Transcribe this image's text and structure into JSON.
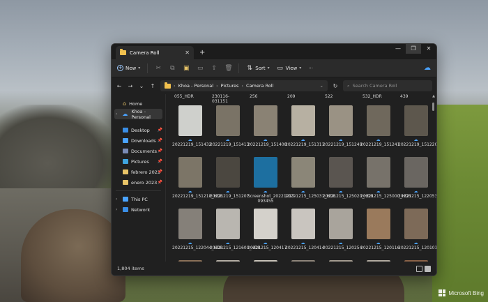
{
  "window": {
    "tab_title": "Camera Roll",
    "new_tab": "+",
    "close": "✕",
    "minimize": "—",
    "maximize": "❐",
    "window_close": "✕"
  },
  "toolbar": {
    "new_label": "New",
    "sort_label": "Sort",
    "view_label": "View",
    "more": "···"
  },
  "address": {
    "crumbs": [
      "Khoa - Personal",
      "Pictures",
      "Camera Roll"
    ],
    "search_placeholder": "Search Camera Roll"
  },
  "sidebar": {
    "home": "Home",
    "personal": "Khoa - Personal",
    "quick": [
      {
        "label": "Desktop",
        "color": "#3a8ee6"
      },
      {
        "label": "Downloads",
        "color": "#4aa3ff"
      },
      {
        "label": "Documents",
        "color": "#7a8bb5"
      },
      {
        "label": "Pictures",
        "color": "#3fa5e0"
      },
      {
        "label": "febrero 2023",
        "color": "#e8c468"
      },
      {
        "label": "enero 2023",
        "color": "#e8c468"
      }
    ],
    "this_pc": "This PC",
    "network": "Network"
  },
  "top_row": [
    "055_HDR",
    "230116-031151",
    "256",
    "209",
    "522",
    "532_HDR",
    "439"
  ],
  "files": [
    {
      "name": "20221219_151432",
      "bg": "#cfd0cc"
    },
    {
      "name": "20221219_151413",
      "bg": "#7a7366"
    },
    {
      "name": "20221219_151408",
      "bg": "#8a8274"
    },
    {
      "name": "20221219_151311",
      "bg": "#b7b0a2"
    },
    {
      "name": "20221219_151249",
      "bg": "#9a9284"
    },
    {
      "name": "20221219_151241",
      "bg": "#6f685c"
    },
    {
      "name": "20221219_151220_HDR",
      "bg": "#5d574d"
    },
    {
      "name": "20221219_151218_HDR",
      "bg": "#7c7567"
    },
    {
      "name": "20221219_151207",
      "bg": "#4b4740"
    },
    {
      "name": "Screenshot_20221217-093455",
      "bg": "#1d6fa0"
    },
    {
      "name": "20221215_125031_HDR",
      "bg": "#8b8678"
    },
    {
      "name": "20221215_125020_HDR",
      "bg": "#5a5550"
    },
    {
      "name": "20221215_125000_HDR",
      "bg": "#77726a"
    },
    {
      "name": "20221215_122053_HDR",
      "bg": "#6a6661"
    },
    {
      "name": "20221215_122044_HDR",
      "bg": "#858079"
    },
    {
      "name": "20221215_121600_HDR",
      "bg": "#b9b6b0"
    },
    {
      "name": "20221215_120417",
      "bg": "#d4d1cb"
    },
    {
      "name": "20221215_120414",
      "bg": "#c9c5bf"
    },
    {
      "name": "20221215_120254",
      "bg": "#a9a49c"
    },
    {
      "name": "20221215_120116",
      "bg": "#9a7a5c"
    },
    {
      "name": "20221215_120101",
      "bg": "#7d6a58"
    },
    {
      "name": "",
      "bg": "#8a7058"
    },
    {
      "name": "",
      "bg": "#b4aea4"
    },
    {
      "name": "",
      "bg": "#c8c2b8"
    },
    {
      "name": "",
      "bg": "#8e857a"
    },
    {
      "name": "",
      "bg": "#a39b8f"
    },
    {
      "name": "",
      "bg": "#b2aba0"
    },
    {
      "name": "",
      "bg": "#8a6248"
    }
  ],
  "status": {
    "items": "1,804 items"
  },
  "desktop": {
    "bing": "Microsoft Bing"
  }
}
